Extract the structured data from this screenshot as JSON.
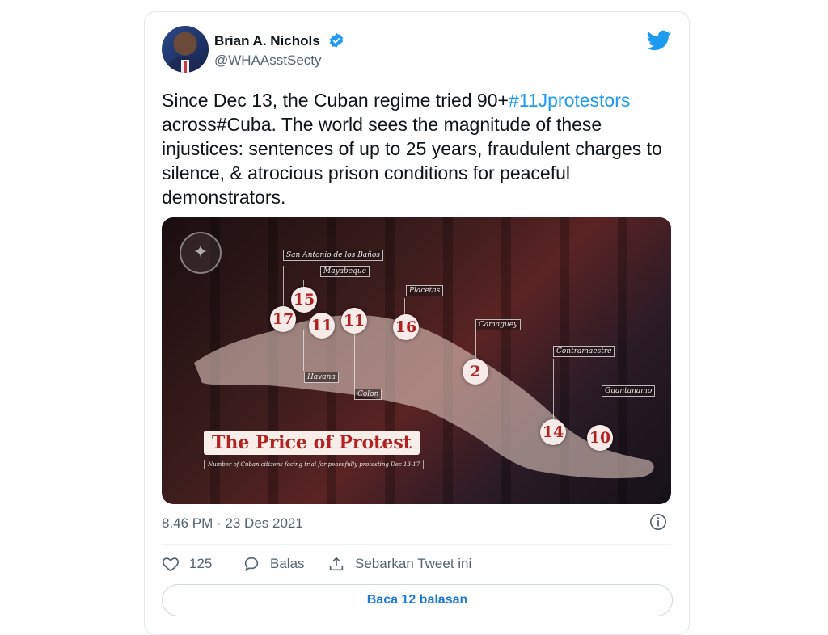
{
  "author": {
    "name": "Brian A. Nichols",
    "handle": "@WHAAsstSecty"
  },
  "tweet": {
    "text_pre": "Since Dec 13, the Cuban regime tried 90+",
    "hashtag": "#11Jprotestors",
    "text_post": " across#Cuba.  The world sees the magnitude of these injustices: sentences of up to 25 years, fraudulent charges to silence, & atrocious prison conditions for peaceful demonstrators."
  },
  "media": {
    "banner_title": "The Price of Protest",
    "banner_subtitle": "Number of Cuban citizens facing trial for peacefully protesting Dec 13-17",
    "locations": [
      "San Antonio de los Baños",
      "Mayabeque",
      "Placetas",
      "Camaguey",
      "Contramaestre",
      "Guantanamo",
      "Havana",
      "Colon"
    ],
    "counts": [
      "17",
      "15",
      "11",
      "11",
      "16",
      "2",
      "14",
      "10"
    ]
  },
  "timestamp": "8.46 PM · 23 Des 2021",
  "actions": {
    "likes": "125",
    "reply_label": "Balas",
    "share_label": "Sebarkan Tweet ini"
  },
  "read_replies_label": "Baca 12 balasan",
  "colors": {
    "link": "#1d9bf0",
    "verified": "#1d9bf0",
    "accent_red": "#b32222"
  }
}
